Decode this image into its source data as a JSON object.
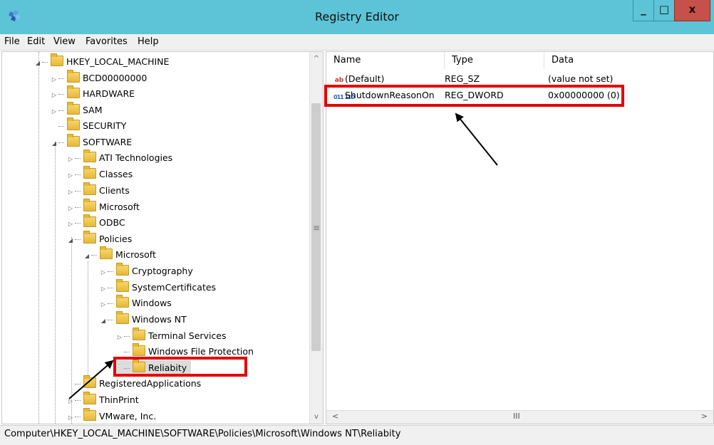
{
  "window": {
    "title": "Registry Editor"
  },
  "menu": [
    {
      "label": "File"
    },
    {
      "label": "Edit"
    },
    {
      "label": "View"
    },
    {
      "label": "Favorites"
    },
    {
      "label": "Help"
    }
  ],
  "tree": [
    {
      "label": "HKEY_LOCAL_MACHINE",
      "expander": "◢"
    },
    {
      "label": "BCD00000000",
      "expander": "▷"
    },
    {
      "label": "HARDWARE",
      "expander": "▷"
    },
    {
      "label": "SAM",
      "expander": "▷"
    },
    {
      "label": "SECURITY",
      "expander": ""
    },
    {
      "label": "SOFTWARE",
      "expander": "◢"
    },
    {
      "label": "ATI Technologies",
      "expander": "▷"
    },
    {
      "label": "Classes",
      "expander": "▷"
    },
    {
      "label": "Clients",
      "expander": "▷"
    },
    {
      "label": "Microsoft",
      "expander": "▷"
    },
    {
      "label": "ODBC",
      "expander": "▷"
    },
    {
      "label": "Policies",
      "expander": "◢"
    },
    {
      "label": "Microsoft",
      "expander": "◢"
    },
    {
      "label": "Cryptography",
      "expander": "▷"
    },
    {
      "label": "SystemCertificates",
      "expander": "▷"
    },
    {
      "label": "Windows",
      "expander": "▷"
    },
    {
      "label": "Windows NT",
      "expander": "◢"
    },
    {
      "label": "Terminal Services",
      "expander": "▷"
    },
    {
      "label": "Windows File Protection",
      "expander": ""
    },
    {
      "label": "Reliabity",
      "expander": ""
    },
    {
      "label": "RegisteredApplications",
      "expander": ""
    },
    {
      "label": "ThinPrint",
      "expander": "▷"
    },
    {
      "label": "VMware, Inc.",
      "expander": "▷"
    }
  ],
  "columns": {
    "name": "Name",
    "type": "Type",
    "data": "Data"
  },
  "values": [
    {
      "icon": "ab",
      "name": "(Default)",
      "type": "REG_SZ",
      "data": "(value not set)"
    },
    {
      "icon": "011 110",
      "name": "ShutdownReasonOn",
      "type": "REG_DWORD",
      "data": "0x00000000 (0)"
    }
  ],
  "status": {
    "path": "Computer\\HKEY_LOCAL_MACHINE\\SOFTWARE\\Policies\\Microsoft\\Windows NT\\Reliabity"
  },
  "icons": {
    "close": "x",
    "minimize": "_",
    "maximize": "□",
    "grip": "≡",
    "scroll_up": "^",
    "scroll_down": "v",
    "scroll_left": "<",
    "scroll_right": ">",
    "scroll_thumb": "III"
  },
  "colors": {
    "titlebar": "#5cc4d6",
    "close": "#c7504a",
    "highlight": "#e60000"
  }
}
